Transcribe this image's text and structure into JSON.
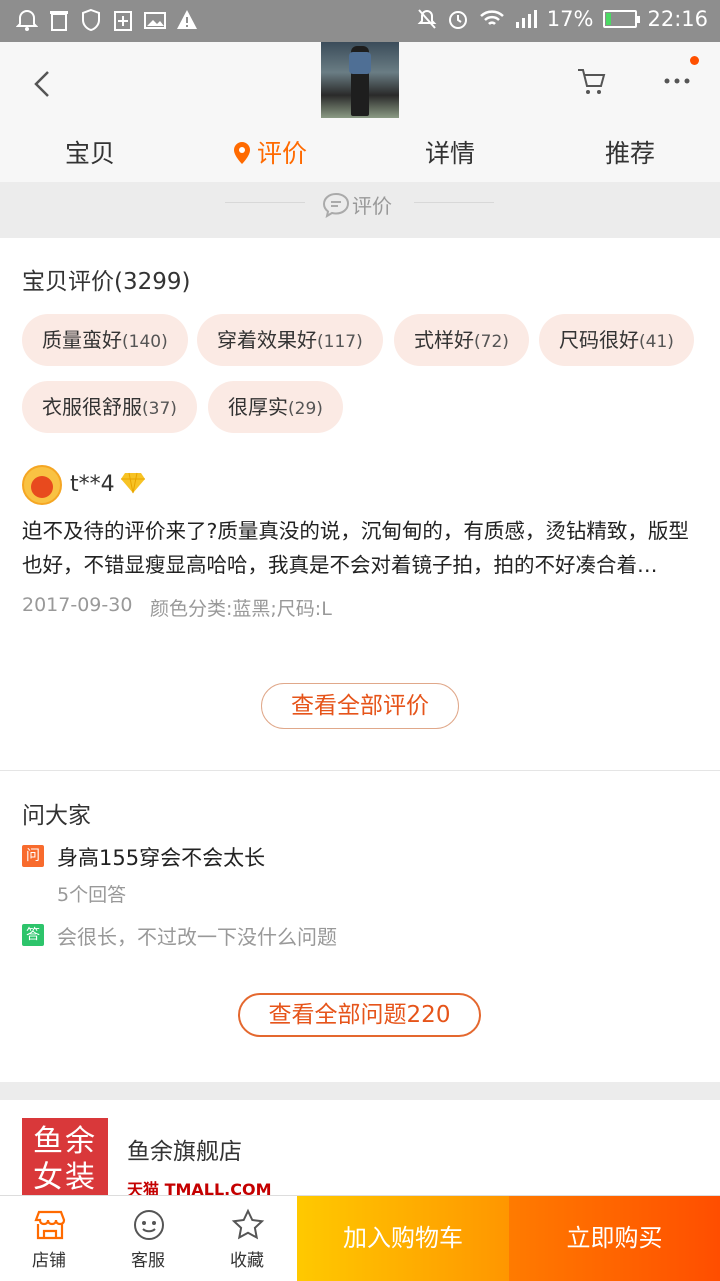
{
  "status_bar": {
    "battery": "17%",
    "time": "22:16",
    "battery_level": 0.17
  },
  "tabs": [
    {
      "label": "宝贝"
    },
    {
      "label": "评价"
    },
    {
      "label": "详情"
    },
    {
      "label": "推荐"
    }
  ],
  "section_label": "评价",
  "reviews": {
    "title": "宝贝评价(3299)",
    "tags": [
      {
        "label": "质量蛮好",
        "count": "(140)"
      },
      {
        "label": "穿着效果好",
        "count": "(117)"
      },
      {
        "label": "式样好",
        "count": "(72)"
      },
      {
        "label": "尺码很好",
        "count": "(41)"
      },
      {
        "label": "衣服很舒服",
        "count": "(37)"
      },
      {
        "label": "很厚实",
        "count": "(29)"
      }
    ],
    "item": {
      "name": "t**4",
      "text": "迫不及待的评价来了?质量真没的说，沉甸甸的，有质感，烫钻精致，版型也好，不错显瘦显高哈哈，我真是不会对着镜子拍，拍的不好凑合着…",
      "date": "2017-09-30",
      "sku": "颜色分类:蓝黑;尺码:L"
    },
    "view_all": "查看全部评价"
  },
  "qa": {
    "title": "问大家",
    "q_badge": "问",
    "question": "身高155穿会不会太长",
    "answers": "5个回答",
    "a_badge": "答",
    "answer": "会很长，不过改一下没什么问题",
    "view_all": "查看全部问题220"
  },
  "store": {
    "logo_line1": "鱼余",
    "logo_line2": "女装",
    "name": "鱼余旗舰店",
    "tmall": "天猫 TMALL.COM"
  },
  "bottom_bar": {
    "store": "店铺",
    "service": "客服",
    "favorite": "收藏",
    "add_to_cart": "加入购物车",
    "buy_now": "立即购买"
  },
  "colors": {
    "accent": "#ff6a00",
    "cart_gradient": "#ffc900",
    "buy_gradient": "#ff4e00"
  }
}
